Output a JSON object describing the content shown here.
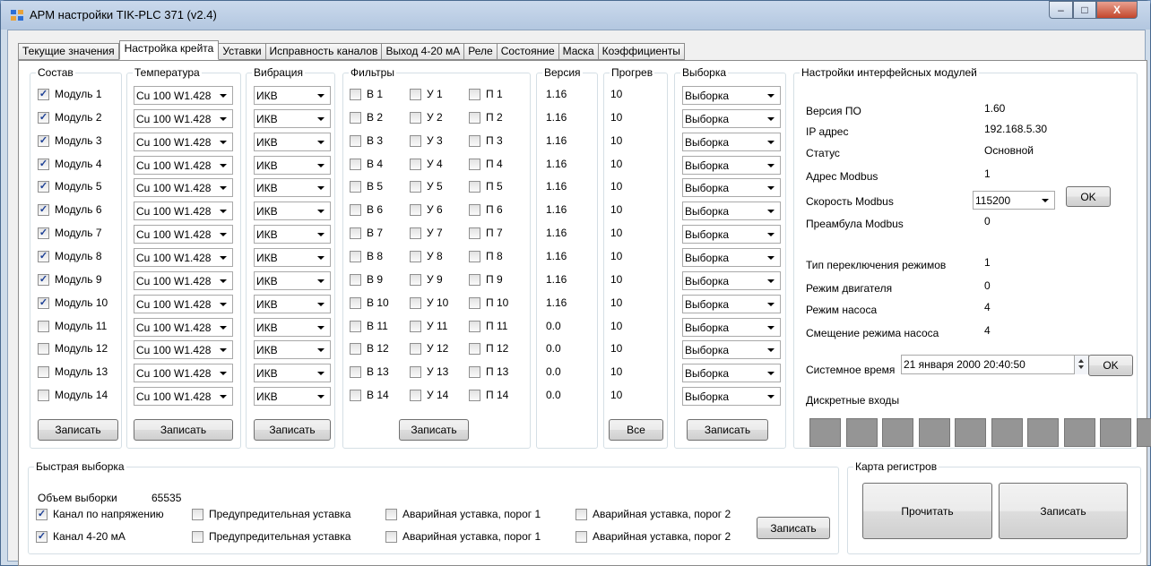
{
  "window": {
    "title": "АРМ настройки TIK-PLC 371 (v2.4)",
    "min": "–",
    "max": "□",
    "close": "X"
  },
  "tabs": [
    "Текущие значения",
    "Настройка крейта",
    "Уставки",
    "Исправность каналов",
    "Выход 4-20 мА",
    "Реле",
    "Состояние",
    "Маска",
    "Коэффициенты"
  ],
  "groups": {
    "sostav": "Состав",
    "temperature": "Температура",
    "vibration": "Вибрация",
    "filters": "Фильтры",
    "version": "Версия",
    "warmup": "Прогрев",
    "sample": "Выборка",
    "interface": "Настройки интерфейсных модулей",
    "fast": "Быстрая выборка",
    "regmap": "Карта регистров"
  },
  "modules": [
    {
      "name": "Модуль 1",
      "checked": true,
      "temp": "Cu 100 W1.428",
      "vib": "ИКВ",
      "b": "В 1",
      "u": "У 1",
      "p": "П 1",
      "version": "1.16",
      "warmup": "10",
      "sample": "Выборка"
    },
    {
      "name": "Модуль 2",
      "checked": true,
      "temp": "Cu 100 W1.428",
      "vib": "ИКВ",
      "b": "В 2",
      "u": "У 2",
      "p": "П 2",
      "version": "1.16",
      "warmup": "10",
      "sample": "Выборка"
    },
    {
      "name": "Модуль 3",
      "checked": true,
      "temp": "Cu 100 W1.428",
      "vib": "ИКВ",
      "b": "В 3",
      "u": "У 3",
      "p": "П 3",
      "version": "1.16",
      "warmup": "10",
      "sample": "Выборка"
    },
    {
      "name": "Модуль 4",
      "checked": true,
      "temp": "Cu 100 W1.428",
      "vib": "ИКВ",
      "b": "В 4",
      "u": "У 4",
      "p": "П 4",
      "version": "1.16",
      "warmup": "10",
      "sample": "Выборка"
    },
    {
      "name": "Модуль 5",
      "checked": true,
      "temp": "Cu 100 W1.428",
      "vib": "ИКВ",
      "b": "В 5",
      "u": "У 5",
      "p": "П 5",
      "version": "1.16",
      "warmup": "10",
      "sample": "Выборка"
    },
    {
      "name": "Модуль 6",
      "checked": true,
      "temp": "Cu 100 W1.428",
      "vib": "ИКВ",
      "b": "В 6",
      "u": "У 6",
      "p": "П 6",
      "version": "1.16",
      "warmup": "10",
      "sample": "Выборка"
    },
    {
      "name": "Модуль 7",
      "checked": true,
      "temp": "Cu 100 W1.428",
      "vib": "ИКВ",
      "b": "В 7",
      "u": "У 7",
      "p": "П 7",
      "version": "1.16",
      "warmup": "10",
      "sample": "Выборка"
    },
    {
      "name": "Модуль 8",
      "checked": true,
      "temp": "Cu 100 W1.428",
      "vib": "ИКВ",
      "b": "В 8",
      "u": "У 8",
      "p": "П 8",
      "version": "1.16",
      "warmup": "10",
      "sample": "Выборка"
    },
    {
      "name": "Модуль 9",
      "checked": true,
      "temp": "Cu 100 W1.428",
      "vib": "ИКВ",
      "b": "В 9",
      "u": "У 9",
      "p": "П 9",
      "version": "1.16",
      "warmup": "10",
      "sample": "Выборка"
    },
    {
      "name": "Модуль 10",
      "checked": true,
      "temp": "Cu 100 W1.428",
      "vib": "ИКВ",
      "b": "В 10",
      "u": "У 10",
      "p": "П 10",
      "version": "1.16",
      "warmup": "10",
      "sample": "Выборка"
    },
    {
      "name": "Модуль 11",
      "checked": false,
      "temp": "Cu 100 W1.428",
      "vib": "ИКВ",
      "b": "В 11",
      "u": "У 11",
      "p": "П 11",
      "version": "0.0",
      "warmup": "10",
      "sample": "Выборка"
    },
    {
      "name": "Модуль 12",
      "checked": false,
      "temp": "Cu 100 W1.428",
      "vib": "ИКВ",
      "b": "В 12",
      "u": "У 12",
      "p": "П 12",
      "version": "0.0",
      "warmup": "10",
      "sample": "Выборка"
    },
    {
      "name": "Модуль 13",
      "checked": false,
      "temp": "Cu 100 W1.428",
      "vib": "ИКВ",
      "b": "В 13",
      "u": "У 13",
      "p": "П 13",
      "version": "0.0",
      "warmup": "10",
      "sample": "Выборка"
    },
    {
      "name": "Модуль 14",
      "checked": false,
      "temp": "Cu 100 W1.428",
      "vib": "ИКВ",
      "b": "В 14",
      "u": "У 14",
      "p": "П 14",
      "version": "0.0",
      "warmup": "10",
      "sample": "Выборка"
    }
  ],
  "buttons": {
    "write": "Записать",
    "all": "Все",
    "ok": "OK",
    "read": "Прочитать"
  },
  "iface": {
    "version_label": "Версия ПО",
    "version_value": "1.60",
    "ip_label": "IP адрес",
    "ip_value": "192.168.5.30",
    "status_label": "Статус",
    "status_value": "Основной",
    "addr_label": "Адрес Modbus",
    "addr_value": "1",
    "speed_label": "Скорость Modbus",
    "speed_value": "115200",
    "preamble_label": "Преамбула Modbus",
    "preamble_value": "0",
    "switch_label": "Тип переключения режимов",
    "switch_value": "1",
    "engine_label": "Режим двигателя",
    "engine_value": "0",
    "pump_label": "Режим насоса",
    "pump_value": "4",
    "pumpshift_label": "Смещение режима насоса",
    "pumpshift_value": "4",
    "systime_label": "Системное время",
    "systime_value": "21 января 2000 20:40:50",
    "discrete_label": "Дискретные входы"
  },
  "discrete_inputs": [
    0,
    0,
    0,
    0,
    0,
    0,
    0,
    0,
    0,
    0
  ],
  "fast": {
    "volume_label": "Объем выборки",
    "volume_value": "65535",
    "row1": [
      {
        "label": "Канал по напряжению",
        "checked": true
      },
      {
        "label": "Предупредительная уставка",
        "checked": false
      },
      {
        "label": "Аварийная уставка, порог 1",
        "checked": false
      },
      {
        "label": "Аварийная уставка, порог 2",
        "checked": false
      }
    ],
    "row2": [
      {
        "label": "Канал 4-20 мА",
        "checked": true
      },
      {
        "label": "Предупредительная уставка",
        "checked": false
      },
      {
        "label": "Аварийная уставка, порог 1",
        "checked": false
      },
      {
        "label": "Аварийная уставка, порог 2",
        "checked": false
      }
    ]
  },
  "colors": {
    "check": "#1c3f95",
    "discrete_off": "#959595"
  }
}
